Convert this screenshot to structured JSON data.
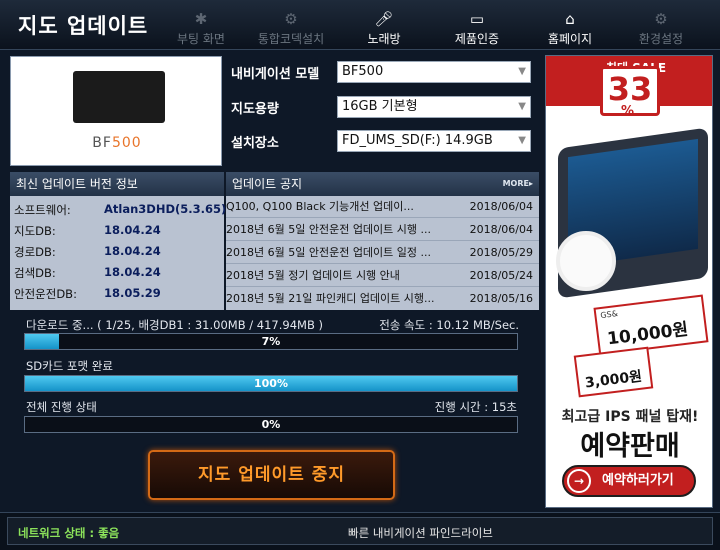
{
  "window": {
    "title": "지도 업데이트"
  },
  "nav": [
    {
      "label": "부팅 화면",
      "icon": "loading-spinner-icon"
    },
    {
      "label": "통합코덱설치",
      "icon": "gear-icon"
    },
    {
      "label": "노래방",
      "icon": "microphone-icon"
    },
    {
      "label": "제품인증",
      "icon": "monitor-icon"
    },
    {
      "label": "홈페이지",
      "icon": "home-icon"
    },
    {
      "label": "환경설정",
      "icon": "settings-icon"
    }
  ],
  "device": {
    "brand_prefix": "BF",
    "brand_suffix": "500"
  },
  "settings": {
    "model_label": "내비게이션 모델",
    "model_value": "BF500",
    "capacity_label": "지도용량",
    "capacity_value": "16GB 기본형",
    "location_label": "설치장소",
    "location_value": "FD_UMS_SD(F:) 14.9GB"
  },
  "version_info": {
    "title": "최신 업데이트 버전 정보",
    "rows": [
      {
        "label": "소프트웨어:",
        "value": "Atlan3DHD(5.3.65)"
      },
      {
        "label": "지도DB:",
        "value": "18.04.24"
      },
      {
        "label": "경로DB:",
        "value": "18.04.24"
      },
      {
        "label": "검색DB:",
        "value": "18.04.24"
      },
      {
        "label": "안전운전DB:",
        "value": "18.05.29"
      }
    ]
  },
  "notices": {
    "title": "업데이트 공지",
    "more_label": "MORE▸",
    "items": [
      {
        "title": "Q100, Q100 Black 기능개선 업데이...",
        "date": "2018/06/04"
      },
      {
        "title": "2018년 6월 5일 안전운전 업데이트 시행 ...",
        "date": "2018/06/04"
      },
      {
        "title": "2018년 6월 5일 안전운전 업데이트 일정 ...",
        "date": "2018/05/29"
      },
      {
        "title": "2018년 5월 정기 업데이트 시행 안내",
        "date": "2018/05/24"
      },
      {
        "title": "2018년 5월 21일 파인캐디 업데이트 시행...",
        "date": "2018/05/16"
      }
    ]
  },
  "progress": {
    "download_text": "다운로드 중... ( 1/25, 배경DB1 : 31.00MB / 417.94MB )",
    "speed_text": "전송 속도 : 10.12 MB/Sec.",
    "download_pct": 0.07,
    "download_label": "7%",
    "format_text": "SD카드 포맷 완료",
    "format_pct": 1.0,
    "format_label": "100%",
    "overall_text": "전체 진행 상태",
    "time_text": "진행 시간 : 15초",
    "overall_pct": 0.0,
    "overall_label": "0%"
  },
  "stop_button": "지도 업데이트 중지",
  "status": {
    "network": "네트워크 상태 : 좋음",
    "slogan": "빠른 내비게이션 파인드라이브"
  },
  "ad": {
    "sale_text": "최대 SALE",
    "sale_num": "33",
    "sale_pct": "%",
    "coupon1_brand": "GS&",
    "coupon1_amount": "10,000원",
    "coupon2_amount": "3,000원",
    "headline1": "최고급 IPS 패널 탑재!",
    "headline2": "예약판매",
    "button": "예약하러가기"
  },
  "colors": {
    "accent_orange": "#ff9a2a",
    "progress_blue": "#29aee0",
    "network_green": "#8ce35b",
    "sale_red": "#c21f1f"
  }
}
